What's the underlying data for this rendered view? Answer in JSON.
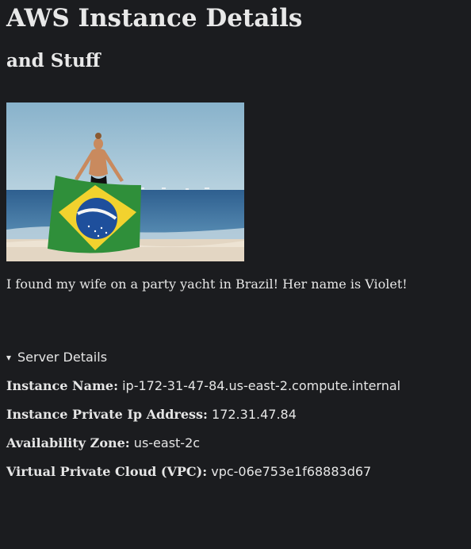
{
  "page": {
    "title": "AWS Instance Details",
    "subtitle": "and Stuff",
    "caption": "I found my wife on a party yacht in Brazil! Her name is Violet!"
  },
  "details": {
    "summary": "Server Details",
    "rows": [
      {
        "label": "Instance Name:",
        "value": "ip-172-31-47-84.us-east-2.compute.internal"
      },
      {
        "label": "Instance Private Ip Address:",
        "value": "172.31.47.84"
      },
      {
        "label": "Availability Zone:",
        "value": "us-east-2c"
      },
      {
        "label": "Virtual Private Cloud (VPC):",
        "value": "vpc-06e753e1f68883d67"
      }
    ]
  },
  "colors": {
    "background": "#1b1c1f",
    "text": "#e6e6e6",
    "sky": "#8fb5cc",
    "sea": "#3e6f9e",
    "sand": "#e6d8c4",
    "flag_green": "#2f8f3a",
    "flag_yellow": "#f2d22e",
    "flag_blue": "#1e4f9c"
  }
}
